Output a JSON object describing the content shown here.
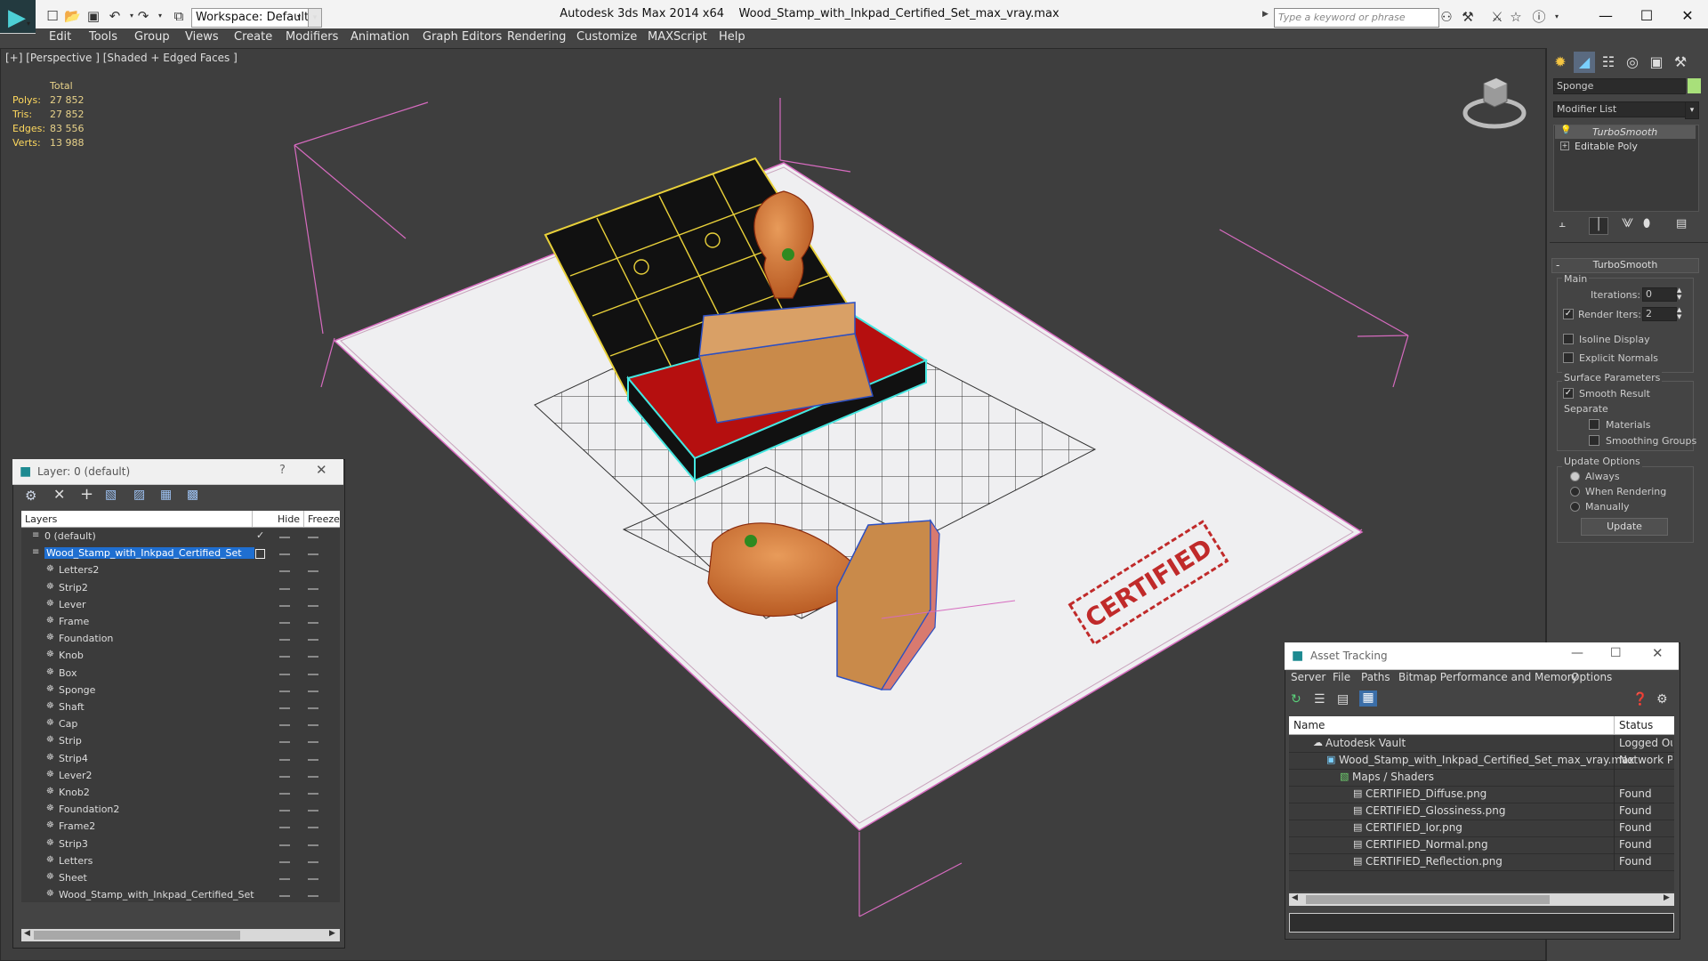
{
  "app": {
    "title": "Autodesk 3ds Max  2014 x64",
    "file": "Wood_Stamp_with_Inkpad_Certified_Set_max_vray.max",
    "workspace": "Workspace: Default",
    "search_placeholder": "Type a keyword or phrase"
  },
  "menu": [
    "Edit",
    "Tools",
    "Group",
    "Views",
    "Create",
    "Modifiers",
    "Animation",
    "Graph Editors",
    "Rendering",
    "Customize",
    "MAXScript",
    "Help"
  ],
  "viewport": {
    "label": "[+] [Perspective ] [Shaded + Edged Faces ]",
    "stats_header": "Total",
    "stats": [
      {
        "label": "Polys:",
        "value": "27 852"
      },
      {
        "label": "Tris:",
        "value": "27 852"
      },
      {
        "label": "Edges:",
        "value": "83 556"
      },
      {
        "label": "Verts:",
        "value": "13 988"
      }
    ],
    "paper_text": "CERTIFIED"
  },
  "command_panel": {
    "object_name": "Sponge",
    "object_color": "#a8e07a",
    "modifier_list": "Modifier List",
    "stack": [
      "TurboSmooth",
      "Editable Poly"
    ],
    "rollout_title": "TurboSmooth",
    "main_label": "Main",
    "iterations_label": "Iterations:",
    "iterations_value": "0",
    "render_iters_label": "Render Iters:",
    "render_iters_value": "2",
    "isoline_label": "Isoline Display",
    "explicit_normals_label": "Explicit Normals",
    "surface_params_label": "Surface Parameters",
    "smooth_result_label": "Smooth Result",
    "separate_label": "Separate",
    "materials_label": "Materials",
    "smoothing_groups_label": "Smoothing Groups",
    "update_options_label": "Update Options",
    "always_label": "Always",
    "when_rendering_label": "When Rendering",
    "manually_label": "Manually",
    "update_button": "Update"
  },
  "layer_window": {
    "title": "Layer: 0 (default)",
    "help": "?",
    "col_layers": "Layers",
    "col_hide": "Hide",
    "col_freeze": "Freeze",
    "layers": [
      {
        "name": "0 (default)",
        "indent": 0,
        "selected": false
      },
      {
        "name": "Wood_Stamp_with_Inkpad_Certified_Set",
        "indent": 0,
        "selected": true
      },
      {
        "name": "Letters2",
        "indent": 1
      },
      {
        "name": "Strip2",
        "indent": 1
      },
      {
        "name": "Lever",
        "indent": 1
      },
      {
        "name": "Frame",
        "indent": 1
      },
      {
        "name": "Foundation",
        "indent": 1
      },
      {
        "name": "Knob",
        "indent": 1
      },
      {
        "name": "Box",
        "indent": 1
      },
      {
        "name": "Sponge",
        "indent": 1
      },
      {
        "name": "Shaft",
        "indent": 1
      },
      {
        "name": "Cap",
        "indent": 1
      },
      {
        "name": "Strip",
        "indent": 1
      },
      {
        "name": "Strip4",
        "indent": 1
      },
      {
        "name": "Lever2",
        "indent": 1
      },
      {
        "name": "Knob2",
        "indent": 1
      },
      {
        "name": "Foundation2",
        "indent": 1
      },
      {
        "name": "Frame2",
        "indent": 1
      },
      {
        "name": "Strip3",
        "indent": 1
      },
      {
        "name": "Letters",
        "indent": 1
      },
      {
        "name": "Sheet",
        "indent": 1
      },
      {
        "name": "Wood_Stamp_with_Inkpad_Certified_Set",
        "indent": 1
      }
    ]
  },
  "asset_window": {
    "title": "Asset Tracking",
    "menu": [
      "Server",
      "File",
      "Paths",
      "Bitmap Performance and Memory",
      "Options"
    ],
    "col_name": "Name",
    "col_status": "Status",
    "rows": [
      {
        "name": "Autodesk Vault",
        "status": "Logged Out",
        "indent": 1
      },
      {
        "name": "Wood_Stamp_with_Inkpad_Certified_Set_max_vray.max",
        "status": "Network Pa",
        "indent": 2
      },
      {
        "name": "Maps / Shaders",
        "status": "",
        "indent": 3
      },
      {
        "name": "CERTIFIED_Diffuse.png",
        "status": "Found",
        "indent": 4
      },
      {
        "name": "CERTIFIED_Glossiness.png",
        "status": "Found",
        "indent": 4
      },
      {
        "name": "CERTIFIED_Ior.png",
        "status": "Found",
        "indent": 4
      },
      {
        "name": "CERTIFIED_Normal.png",
        "status": "Found",
        "indent": 4
      },
      {
        "name": "CERTIFIED_Reflection.png",
        "status": "Found",
        "indent": 4
      }
    ]
  }
}
